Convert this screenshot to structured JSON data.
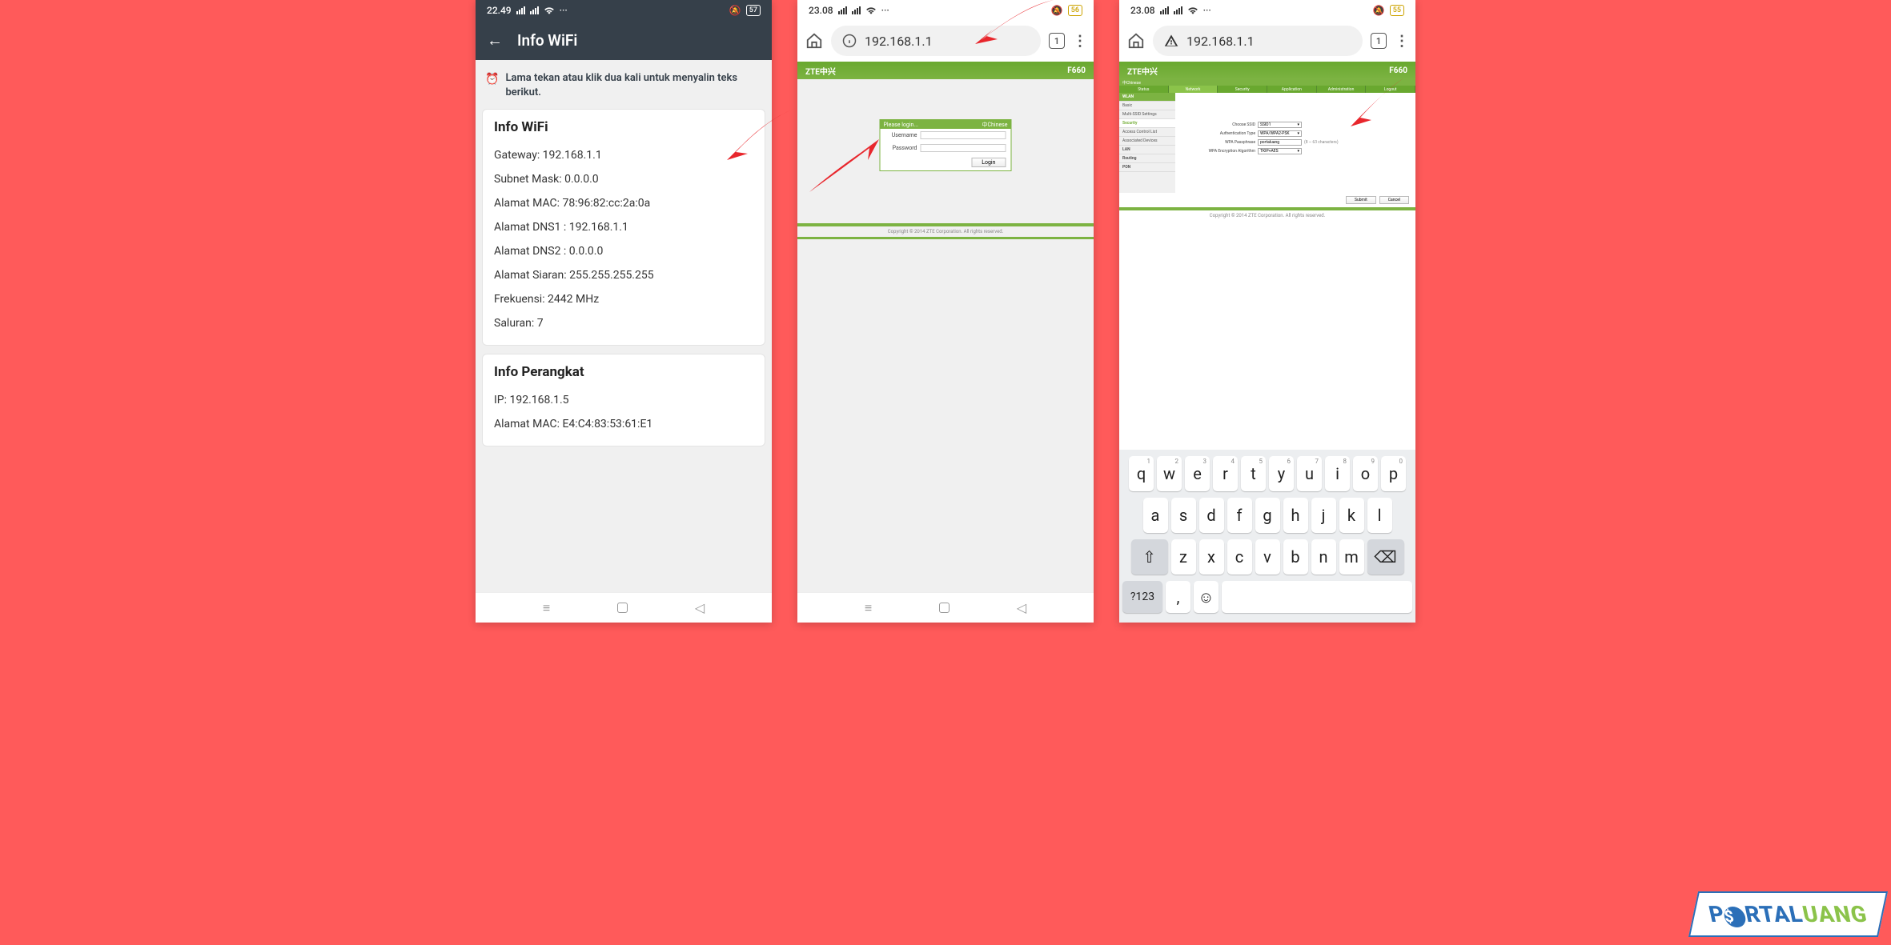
{
  "phone1": {
    "status": {
      "time": "22.49",
      "battery": "57"
    },
    "header": {
      "title": "Info WiFi"
    },
    "hint": "Lama tekan atau klik dua kali untuk menyalin teks berikut.",
    "wifi_card": {
      "title": "Info WiFi",
      "rows": [
        "Gateway: 192.168.1.1",
        "Subnet Mask: 0.0.0.0",
        "Alamat MAC: 78:96:82:cc:2a:0a",
        "Alamat DNS1 : 192.168.1.1",
        "Alamat DNS2 : 0.0.0.0",
        "Alamat Siaran: 255.255.255.255",
        "Frekuensi: 2442 MHz",
        "Saluran: 7"
      ]
    },
    "device_card": {
      "title": "Info Perangkat",
      "rows": [
        "IP: 192.168.1.5",
        "Alamat MAC: E4:C4:83:53:61:E1"
      ]
    }
  },
  "phone2": {
    "status": {
      "time": "23.08",
      "battery": "56"
    },
    "url": "192.168.1.1",
    "tab_count": "1",
    "zte": {
      "brand": "ZTE中兴",
      "model": "F660",
      "login_header": "Please login...",
      "lang_link": "中Chinese",
      "username_label": "Username",
      "password_label": "Password",
      "login_btn": "Login",
      "copyright": "Copyright © 2014 ZTE Corporation. All rights reserved."
    }
  },
  "phone3": {
    "status": {
      "time": "23.08",
      "battery": "55"
    },
    "url": "192.168.1.1",
    "tab_count": "1",
    "zte": {
      "brand": "ZTE中兴",
      "model": "F660",
      "lang_link": "中Chinese",
      "tabs": [
        "Status",
        "Network",
        "Security",
        "Application",
        "Administration",
        "Logout"
      ],
      "side": {
        "header": "WLAN",
        "items": [
          "Basic",
          "Multi-SSID Settings",
          "Security",
          "Access Control List",
          "Associated Devices"
        ],
        "others": [
          "LAN",
          "Routing",
          "PON"
        ]
      },
      "form": {
        "ssid_label": "Choose SSID",
        "ssid_value": "SSID1",
        "auth_label": "Authentication Type",
        "auth_value": "WPA/WPA2-PSK",
        "pass_label": "WPA Passphrase",
        "pass_value": "portaluang",
        "pass_hint": "(8 ~ 63 characters)",
        "enc_label": "WPA Encryption Algorithm",
        "enc_value": "TKIP+AES"
      },
      "submit": "Submit",
      "cancel": "Cancel",
      "copyright": "Copyright © 2014 ZTE Corporation. All rights reserved."
    },
    "keyboard": {
      "row1": [
        [
          "q",
          "1"
        ],
        [
          "w",
          "2"
        ],
        [
          "e",
          "3"
        ],
        [
          "r",
          "4"
        ],
        [
          "t",
          "5"
        ],
        [
          "y",
          "6"
        ],
        [
          "u",
          "7"
        ],
        [
          "i",
          "8"
        ],
        [
          "o",
          "9"
        ],
        [
          "p",
          "0"
        ]
      ],
      "row2": [
        "a",
        "s",
        "d",
        "f",
        "g",
        "h",
        "j",
        "k",
        "l"
      ],
      "row3": [
        "z",
        "x",
        "c",
        "v",
        "b",
        "n",
        "m"
      ],
      "fn": "?123"
    }
  },
  "watermark": "PORTALUANG"
}
